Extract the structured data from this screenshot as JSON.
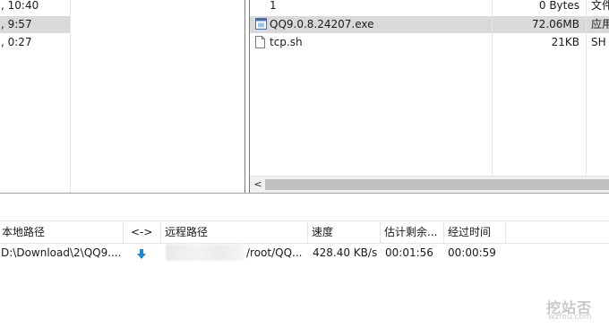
{
  "left_pane": {
    "rows": [
      {
        "text": ", 10:40"
      },
      {
        "text": ", 9:57"
      },
      {
        "text": ", 0:27"
      }
    ]
  },
  "right_pane": {
    "rows": [
      {
        "name": "1",
        "size": "0 Bytes",
        "type": "文件",
        "icon": "folder-file-icon"
      },
      {
        "name": "QQ9.0.8.24207.exe",
        "size": "72.06MB",
        "type": "应用",
        "icon": "exe-file-icon"
      },
      {
        "name": "tcp.sh",
        "size": "21KB",
        "type": "SH 文",
        "icon": "file-icon"
      }
    ],
    "scroll_left": "<"
  },
  "queue": {
    "headers": {
      "local_path": "本地路径",
      "direction": "<->",
      "remote_path": "远程路径",
      "speed": "速度",
      "remaining": "估计剩余...",
      "elapsed": "经过时间"
    },
    "row": {
      "local_path": "D:\\Download\\2\\QQ9....",
      "direction_icon": "download-arrow-icon",
      "remote_path": "/root/QQ...",
      "speed": "428.40 KB/s",
      "remaining": "00:01:56",
      "elapsed": "00:00:59"
    }
  },
  "watermark": {
    "logo": "挖站否",
    "domain": "wzfou.com"
  },
  "colors": {
    "selection": "#d9d9d9",
    "download_arrow": "#1e88d6",
    "watermark": "#c8c8c8"
  }
}
